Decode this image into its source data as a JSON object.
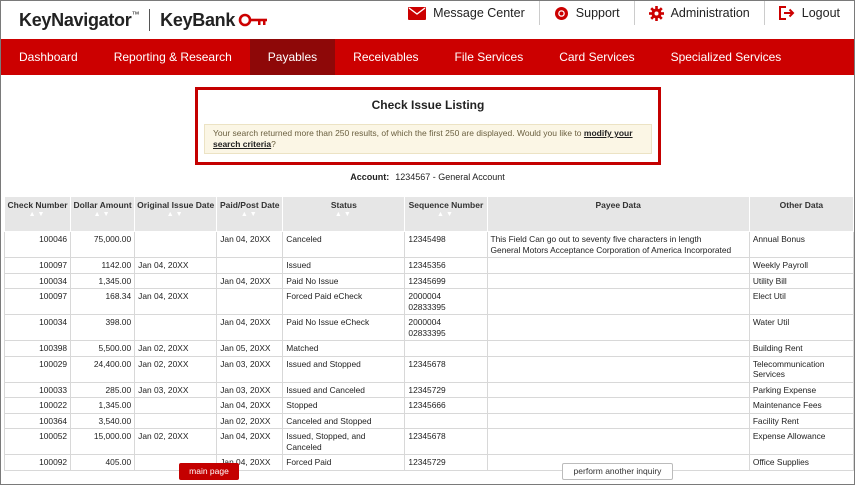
{
  "brand": {
    "keynavigator": "KeyNavigator",
    "tm": "™",
    "keybank": "KeyBank"
  },
  "top_nav": [
    {
      "label": "Message Center",
      "icon": "envelope-icon"
    },
    {
      "label": "Support",
      "icon": "lifebuoy-icon"
    },
    {
      "label": "Administration",
      "icon": "gear-icon"
    },
    {
      "label": "Logout",
      "icon": "logout-icon"
    }
  ],
  "main_nav": [
    {
      "label": "Dashboard",
      "active": false
    },
    {
      "label": "Reporting & Research",
      "active": false
    },
    {
      "label": "Payables",
      "active": true
    },
    {
      "label": "Receivables",
      "active": false
    },
    {
      "label": "File Services",
      "active": false
    },
    {
      "label": "Card Services",
      "active": false
    },
    {
      "label": "Specialized Services",
      "active": false
    }
  ],
  "notice": {
    "title": "Check Issue Listing",
    "message": "Your search returned more than 250 results, of which the first 250 are displayed. Would you like to ",
    "link": "modify your search criteria",
    "suffix": "?"
  },
  "account": {
    "label": "Account:",
    "value": "1234567 - General Account"
  },
  "table": {
    "headers": [
      "Check Number",
      "Dollar Amount",
      "Original Issue Date",
      "Paid/Post Date",
      "Status",
      "Sequence Number",
      "Payee Data",
      "Other Data"
    ],
    "rows": [
      [
        "100046",
        "75,000.00",
        "",
        "Jan 04, 20XX",
        "Canceled",
        "12345498",
        "This Field Can go out to seventy five characters in length\nGeneral Motors Acceptance Corporation of America Incorporated",
        "Annual Bonus"
      ],
      [
        "100097",
        "1142.00",
        "Jan 04, 20XX",
        "",
        "Issued",
        "12345356",
        "",
        "Weekly Payroll"
      ],
      [
        "100034",
        "1,345.00",
        "",
        "Jan 04, 20XX",
        "Paid No Issue",
        "12345699",
        "",
        "Utility Bill"
      ],
      [
        "100097",
        "168.34",
        "Jan 04, 20XX",
        "",
        "Forced Paid eCheck",
        "2000004\n02833395",
        "",
        "Elect Util"
      ],
      [
        "100034",
        "398.00",
        "",
        "Jan 04, 20XX",
        "Paid No Issue eCheck",
        "2000004\n02833395",
        "",
        "Water Util"
      ],
      [
        "100398",
        "5,500.00",
        "Jan 02, 20XX",
        "Jan 05, 20XX",
        "Matched",
        "",
        "",
        "Building Rent"
      ],
      [
        "100029",
        "24,400.00",
        "Jan 02, 20XX",
        "Jan 03, 20XX",
        "Issued and Stopped",
        "12345678",
        "",
        "Telecommunication\nServices"
      ],
      [
        "100033",
        "285.00",
        "Jan 03, 20XX",
        "Jan 03, 20XX",
        "Issued and Canceled",
        "12345729",
        "",
        "Parking Expense"
      ],
      [
        "100022",
        "1,345.00",
        "",
        "Jan 04, 20XX",
        "Stopped",
        "12345666",
        "",
        "Maintenance Fees"
      ],
      [
        "100364",
        "3,540.00",
        "",
        "Jan 02, 20XX",
        "Canceled and Stopped",
        "",
        "",
        "Facility Rent"
      ],
      [
        "100052",
        "15,000.00",
        "Jan 02, 20XX",
        "Jan 04, 20XX",
        "Issued, Stopped, and\nCanceled",
        "12345678",
        "",
        "Expense Allowance"
      ],
      [
        "100092",
        "405.00",
        "",
        "Jan 04, 20XX",
        "Forced Paid",
        "12345729",
        "",
        "Office Supplies"
      ]
    ]
  },
  "buttons": {
    "main_page": "main page",
    "another_inquiry": "perform another inquiry"
  }
}
